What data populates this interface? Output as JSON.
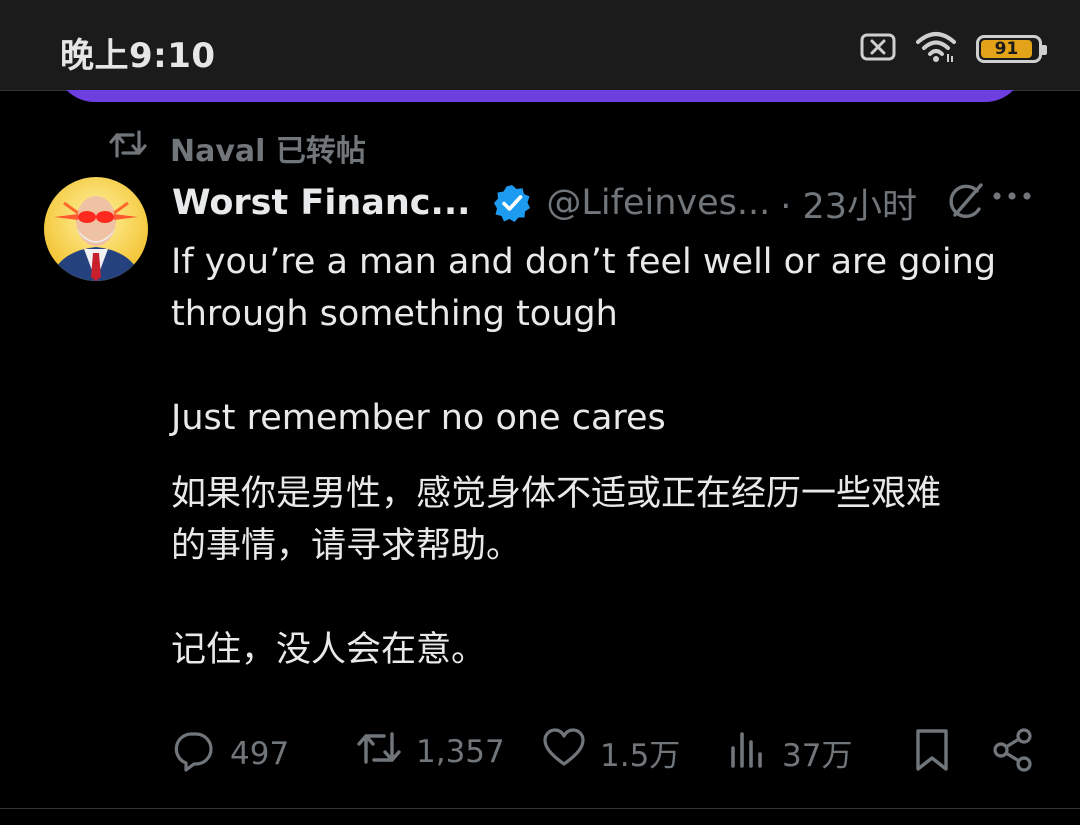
{
  "status_bar": {
    "time": "晚上9:10",
    "battery_level": "91",
    "icons": [
      "sim-off-icon",
      "wifi-icon",
      "battery-icon"
    ],
    "battery_color": "#e3a319"
  },
  "repost": {
    "text": "Naval 已转帖",
    "icon": "repost-icon"
  },
  "tweet": {
    "author_name": "Worst Financ...",
    "handle": "@Lifeinves...",
    "time_ago": "· 23小时",
    "verified_color": "#1d9bf0",
    "body": {
      "en_p1": "If you’re a man and don’t feel well or are going\nthrough something tough",
      "en_p2": "Just remember no one cares",
      "zh_p1": "如果你是男性，感觉身体不适或正在经历一些艰难\n的事情，请寻求帮助。",
      "zh_p2": "记住，没人会在意。"
    }
  },
  "actions": {
    "reply_count": "497",
    "repost_count": "1,357",
    "like_count": "1.5万",
    "views_count": "37万"
  },
  "colors": {
    "background": "#000000",
    "text_primary": "#e7e9ea",
    "text_secondary": "#71767b",
    "accent_pill": "#6d3fe0"
  }
}
